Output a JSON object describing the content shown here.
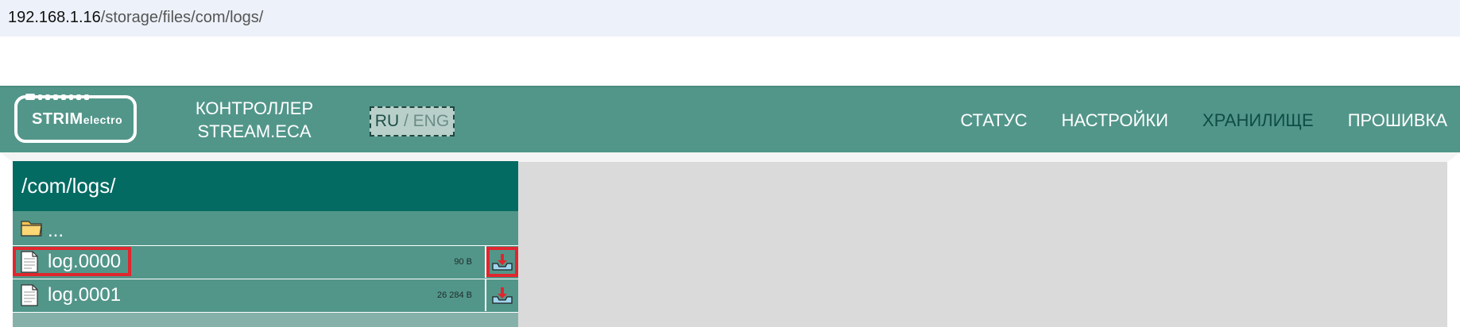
{
  "browser": {
    "url_host": "192.168.1.16",
    "url_path": "/storage/files/com/logs/"
  },
  "header": {
    "logo": {
      "brand": "STRIM",
      "brand_suffix": "electro"
    },
    "title_line1": "КОНТРОЛЛЕР",
    "title_line2": "STREAM.ECA",
    "lang": {
      "ru": "RU",
      "separator": "/",
      "eng": "ENG"
    },
    "nav": [
      {
        "label": "СТАТУС",
        "active": false
      },
      {
        "label": "НАСТРОЙКИ",
        "active": false
      },
      {
        "label": "ХРАНИЛИЩЕ",
        "active": true
      },
      {
        "label": "ПРОШИВКА",
        "active": false
      }
    ]
  },
  "browser_panel": {
    "path": "/com/logs/",
    "parent_label": "...",
    "files": [
      {
        "name": "log.0000",
        "size": "90 B"
      },
      {
        "name": "log.0001",
        "size": "26 284 B"
      }
    ]
  },
  "colors": {
    "header_bg": "#52968a",
    "panel_title_bg": "#036b62",
    "active_nav": "#0f4c43",
    "highlight": "#e0262e",
    "content_bg": "#dadada"
  },
  "icons": {
    "folder": "folder-icon",
    "file": "file-icon",
    "download": "download-icon"
  }
}
